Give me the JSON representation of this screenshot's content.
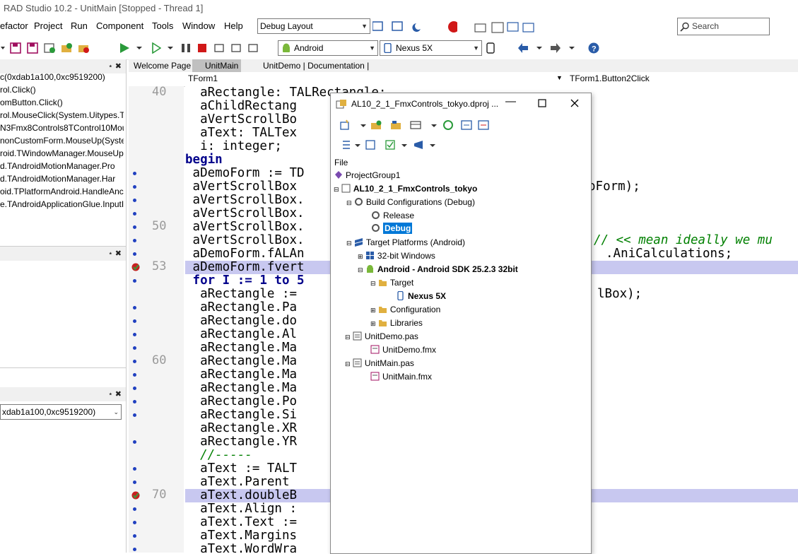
{
  "window": {
    "title": "RAD Studio 10.2 - UnitMain [Stopped - Thread 1]"
  },
  "menu": [
    "efactor",
    "Project",
    "Run",
    "Component",
    "Tools",
    "Window",
    "Help"
  ],
  "layout_selector": {
    "value": "Debug Layout"
  },
  "search": {
    "placeholder": "Search"
  },
  "platform_selector": {
    "value": "Android"
  },
  "device_selector": {
    "value": "Nexus 5X"
  },
  "call_stack": [
    "c(0xdab1a100,0xc9519200)",
    "rol.Click()",
    "omButton.Click()",
    "rol.MouseClick(System.Uitypes.T",
    "N3Fmx8Controls8TControl10Mou",
    "nonCustomForm.MouseUp(Syster",
    "roid.TWindowManager.MouseUp",
    "d.TAndroidMotionManager.Pro",
    "d.TAndroidMotionManager.Har",
    "oid.TPlatformAndroid.HandleAnc",
    "e.TAndroidApplicationGlue.InputI"
  ],
  "local_vars_combo": {
    "value": "xdab1a100,0xc9519200)"
  },
  "editor_tabs": [
    "Welcome Page",
    "UnitMain",
    "UnitDemo | Documentation |"
  ],
  "editor_bar": {
    "unit": "TForm1",
    "method": "TForm1.Button2Click"
  },
  "line_numbers": {
    "l40": "40",
    "l50": "50",
    "l53": "53",
    "l60": "60",
    "l70": "70"
  },
  "code_lines": [
    "  aRectangle: TALRectangle;",
    "  aChildRectang",
    "  aVertScrollBo",
    "  aText: TALTex",
    "  i: integer;",
    "begin",
    " aDemoForm := TD",
    " aVertScrollBox",
    " aVertScrollBox.",
    " aVertScrollBox.",
    " aVertScrollBox.",
    " aVertScrollBox.",
    " aDemoForm.fALAn",
    " aDemoForm.fvert",
    " for I := 1 to 5",
    "  aRectangle :=",
    "  aRectangle.Pa",
    "  aRectangle.do",
    "  aRectangle.Al",
    "  aRectangle.Ma",
    "  aRectangle.Ma",
    "  aRectangle.Ma",
    "  aRectangle.Ma",
    "  aRectangle.Po",
    "  aRectangle.Si",
    "  aRectangle.XR",
    "  aRectangle.YR",
    "  //-----",
    "  aText := TALT",
    "  aText.Parent",
    "  aText.doubleB",
    "  aText.Align :",
    "  aText.Text :=",
    "  aText.Margins",
    "  aText.WordWra"
  ],
  "code_right": {
    "r1": "oForm);",
    "r2": "// << mean ideally we mu",
    "r3": ".AniCalculations;",
    "r4": "lBox);"
  },
  "project_manager": {
    "title": "AL10_2_1_FmxControls_tokyo.dproj ...",
    "menu_file": "File",
    "tree": {
      "group": "ProjectGroup1",
      "project": "AL10_2_1_FmxControls_tokyo",
      "build_configs": "Build Configurations (Debug)",
      "release": "Release",
      "debug": "Debug",
      "target_platforms": "Target Platforms (Android)",
      "win32": "32-bit Windows",
      "android": "Android - Android SDK 25.2.3 32bit",
      "target": "Target",
      "nexus": "Nexus 5X",
      "configuration": "Configuration",
      "libraries": "Libraries",
      "unitdemo_pas": "UnitDemo.pas",
      "unitdemo_fmx": "UnitDemo.fmx",
      "unitmain_pas": "UnitMain.pas",
      "unitmain_fmx": "UnitMain.fmx"
    }
  },
  "colors": {
    "accent": "#0078d7",
    "highlight_line": "#c8c8f0",
    "keyword": "#00008b",
    "comment": "#008000"
  }
}
